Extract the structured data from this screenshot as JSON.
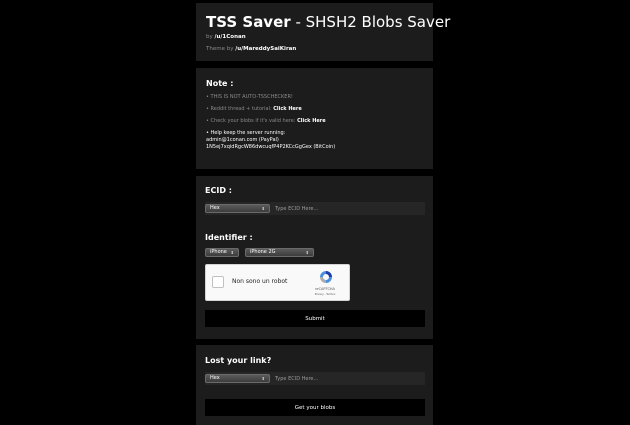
{
  "header": {
    "title_bold": "TSS Saver",
    "title_rest": " - SHSH2 Blobs Saver",
    "by_prefix": "by ",
    "by_user": "/u/1Conan",
    "theme_prefix": "Theme by ",
    "theme_user": "/u/MareddySaiKiran"
  },
  "note": {
    "heading": "Note :",
    "line1": "• THIS IS NOT AUTO-TSSCHECKER!",
    "line2_prefix": "• Reddit thread + tutorial: ",
    "line2_link": "Click Here",
    "line3_prefix": "• Check your blobs if it's valid here: ",
    "line3_link": "Click Here",
    "line4": "• Help keep the server running:",
    "line5": "admin@1conan.com (PayPal)",
    "line6": "1N5ej7xqidRgcW86dwcuqfP4P2KCcGgGex (BitCoin)"
  },
  "form": {
    "ecid_heading": "ECID :",
    "ecid_format": "Hex",
    "ecid_placeholder": "Type ECID Here...",
    "identifier_heading": "Identifier :",
    "device_type": "iPhone",
    "device_model": "iPhone 2G",
    "captcha_label": "Non sono un robot",
    "captcha_brand": "reCAPTCHA",
    "captcha_terms": "Privacy - Termini",
    "submit_label": "Submit"
  },
  "lost": {
    "heading": "Lost your link?",
    "ecid_format": "Hex",
    "ecid_placeholder": "Type ECID Here...",
    "button_label": "Get your blobs"
  }
}
